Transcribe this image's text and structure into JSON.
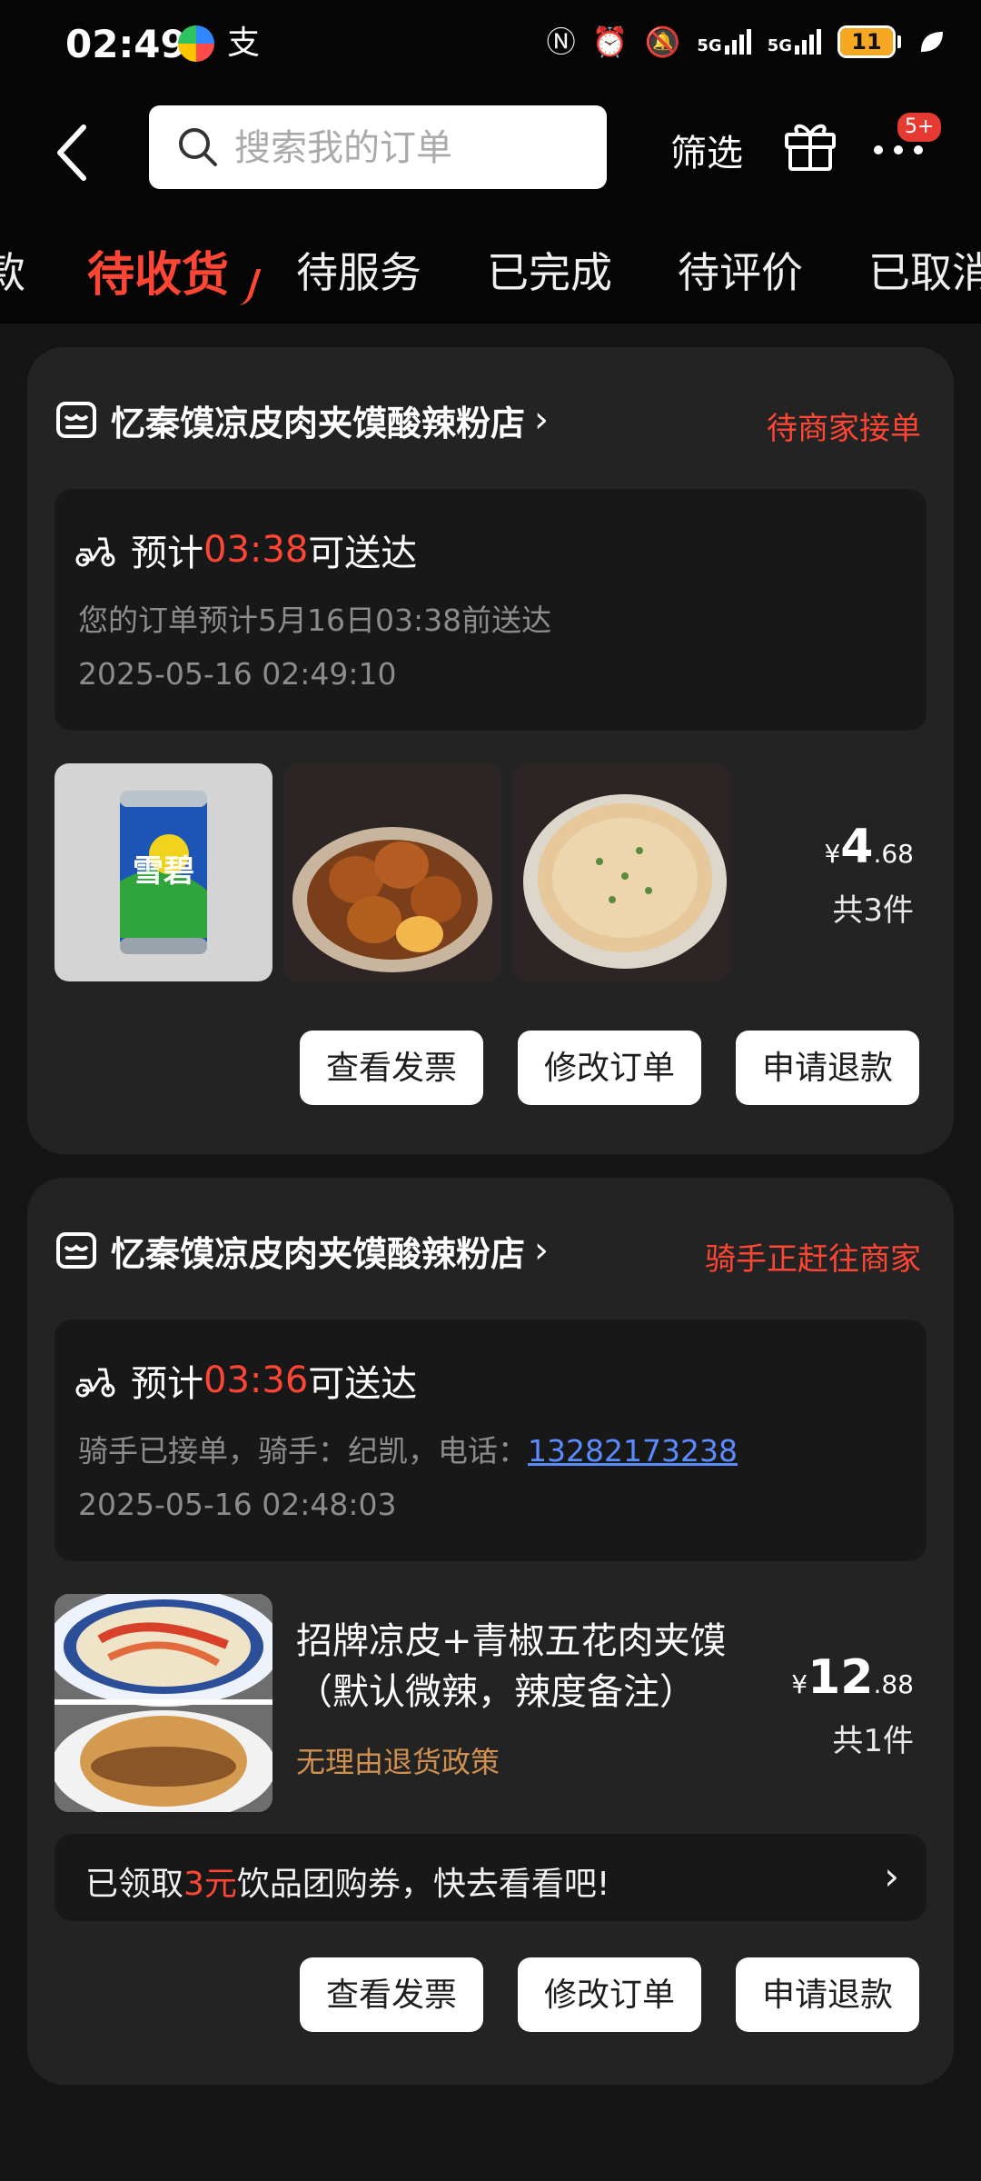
{
  "status_bar": {
    "time": "02:49",
    "battery": "11",
    "network1": "5G",
    "network2": "5G"
  },
  "nav": {
    "search_placeholder": "搜索我的订单",
    "filter_label": "筛选",
    "badge": "5+"
  },
  "tabs": [
    {
      "label": "款"
    },
    {
      "label": "待收货"
    },
    {
      "label": "待服务"
    },
    {
      "label": "已完成"
    },
    {
      "label": "待评价"
    },
    {
      "label": "已取消"
    }
  ],
  "orders": [
    {
      "shop_name": "忆秦馍凉皮肉夹馍酸辣粉店",
      "status": "待商家接单",
      "eta_prefix": "预计",
      "eta_time": "03:38",
      "eta_suffix": "可送达",
      "desc": "您的订单预计5月16日03:38前送达",
      "timestamp": "2025-05-16 02:49:10",
      "items": [
        "雪碧",
        "卤蛋",
        "葱油饼"
      ],
      "price_symbol": "¥",
      "price_int": "4",
      "price_dec": ".68",
      "quantity": "共3件",
      "buttons": {
        "invoice": "查看发票",
        "modify": "修改订单",
        "refund": "申请退款"
      }
    },
    {
      "shop_name": "忆秦馍凉皮肉夹馍酸辣粉店",
      "status": "骑手正赶往商家",
      "eta_prefix": "预计",
      "eta_time": "03:36",
      "eta_suffix": "可送达",
      "desc_prefix": "骑手已接单，骑手：纪凯，电话：",
      "phone": "13282173238",
      "timestamp": "2025-05-16 02:48:03",
      "item_title": "招牌凉皮+青椒五花肉夹馍（默认微辣，辣度备注）",
      "policy": "无理由退货政策",
      "price_symbol": "¥",
      "price_int": "12",
      "price_dec": ".88",
      "quantity": "共1件",
      "coupon_prefix": "已领取",
      "coupon_amount": "3元",
      "coupon_suffix": "饮品团购券，快去看看吧!",
      "buttons": {
        "invoice": "查看发票",
        "modify": "修改订单",
        "refund": "申请退款"
      }
    }
  ],
  "colors": {
    "accent": "#ff4533",
    "link": "#5b8cff",
    "card": "#232323",
    "background": "#151515"
  }
}
